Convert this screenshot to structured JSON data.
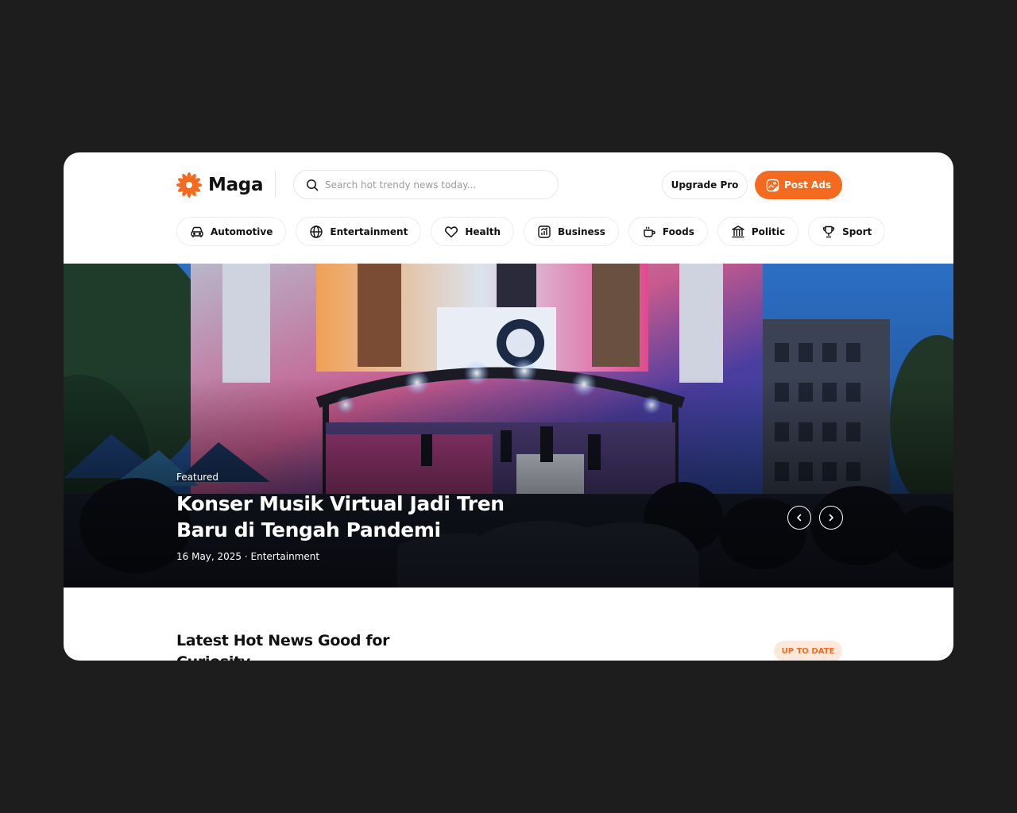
{
  "brand": {
    "name": "Maga",
    "accent_color": "#f46a1e"
  },
  "search": {
    "placeholder": "Search hot trendy news today...",
    "icon": "search-icon"
  },
  "header": {
    "upgrade_label": "Upgrade Pro",
    "post_ads_label": "Post Ads",
    "post_ads_icon": "image-edit-icon"
  },
  "categories": [
    {
      "label": "Automotive",
      "icon": "car-icon"
    },
    {
      "label": "Entertainment",
      "icon": "globe-icon"
    },
    {
      "label": "Health",
      "icon": "heart-icon"
    },
    {
      "label": "Business",
      "icon": "chart-icon"
    },
    {
      "label": "Foods",
      "icon": "cup-icon"
    },
    {
      "label": "Politic",
      "icon": "building-icon"
    },
    {
      "label": "Sport",
      "icon": "trophy-icon"
    }
  ],
  "hero": {
    "label": "Featured",
    "title": "Konser Musik Virtual Jadi Tren Baru di Tengah Pandemi",
    "meta": "16 May, 2025 · Entertainment",
    "prev_icon": "chevron-left-icon",
    "next_icon": "chevron-right-icon"
  },
  "latest": {
    "title": "Latest Hot News Good for Curiosity",
    "badge": "UP TO DATE"
  }
}
